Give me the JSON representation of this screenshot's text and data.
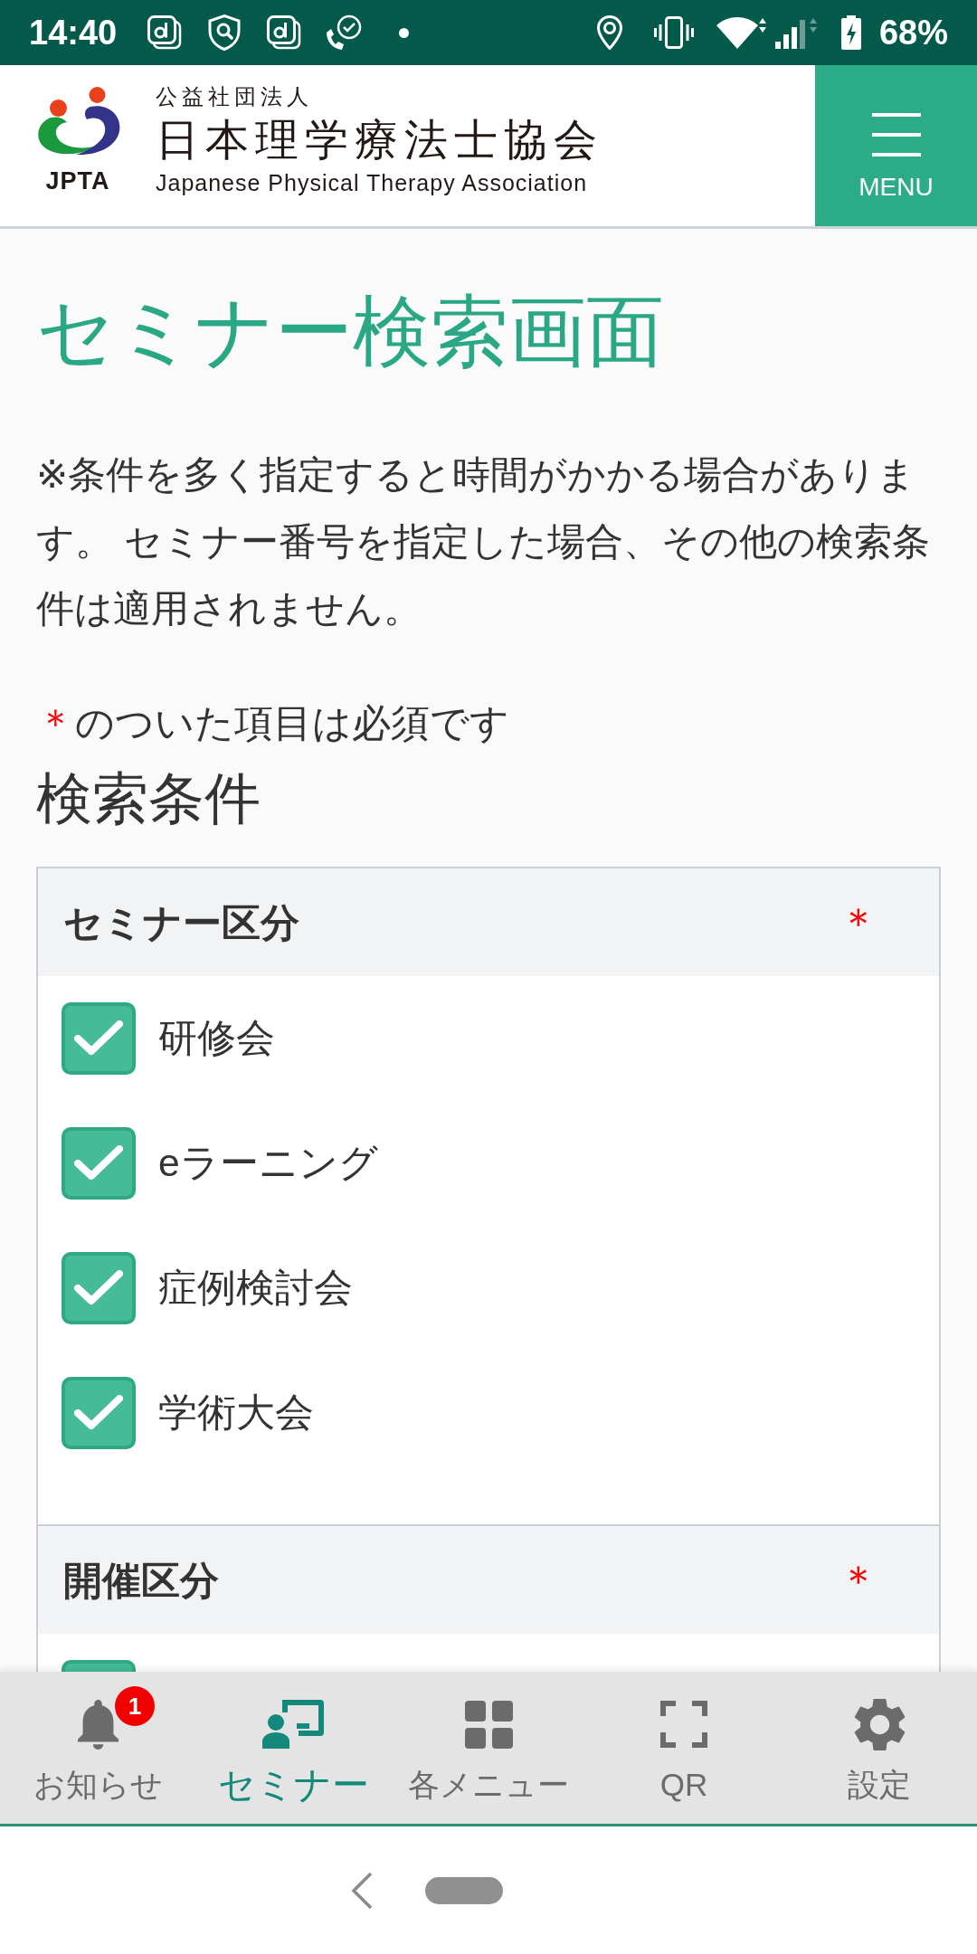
{
  "status_bar": {
    "time": "14:40",
    "battery_text": "68%"
  },
  "header": {
    "logo_text": "JPTA",
    "org_type": "公益社団法人",
    "org_name": "日本理学療法士協会",
    "org_name_en": "Japanese Physical Therapy Association",
    "menu_label": "MENU"
  },
  "page": {
    "title": "セミナー検索画面",
    "notice": "※条件を多く指定すると時間がかかる場合があります。 セミナー番号を指定した場合、その他の検索条件は適用されません。",
    "required_note": {
      "mark": "＊",
      "text": "のついた項目は必須です"
    },
    "section_title": "検索条件"
  },
  "filter_groups": [
    {
      "label": "セミナー区分",
      "required_mark": "＊",
      "options": [
        {
          "label": "研修会",
          "checked": true
        },
        {
          "label": "eラーニング",
          "checked": true
        },
        {
          "label": "症例検討会",
          "checked": true
        },
        {
          "label": "学術大会",
          "checked": true
        }
      ]
    },
    {
      "label": "開催区分",
      "required_mark": "＊",
      "options": [
        {
          "checked": true
        }
      ]
    }
  ],
  "bottom_nav": [
    {
      "label": "お知らせ",
      "selected": false,
      "badge": "1"
    },
    {
      "label": "セミナー",
      "selected": true
    },
    {
      "label": "各メニュー",
      "selected": false
    },
    {
      "label": "QR",
      "selected": false
    },
    {
      "label": "設定",
      "selected": false
    }
  ]
}
